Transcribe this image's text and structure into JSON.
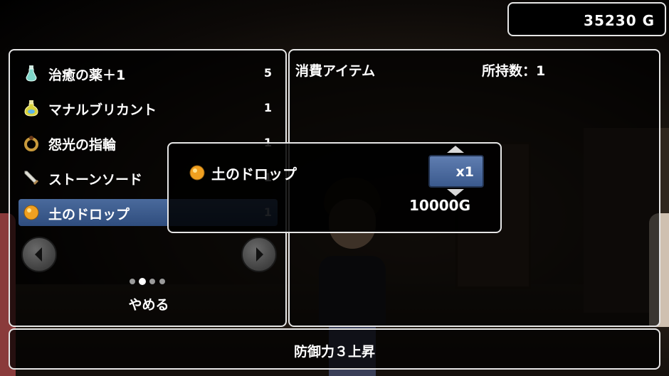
{
  "header": {
    "gold": "35230 G"
  },
  "item_list": {
    "items": [
      {
        "name": "治癒の薬＋1",
        "qty": "5",
        "icon": "potion-icon"
      },
      {
        "name": "マナルブリカント",
        "qty": "1",
        "icon": "mana-bottle-icon"
      },
      {
        "name": "怨光の指輪",
        "qty": "1",
        "icon": "ring-icon"
      },
      {
        "name": "ストーンソード",
        "qty": "1",
        "icon": "sword-icon"
      },
      {
        "name": "土のドロップ",
        "qty": "1",
        "icon": "orb-icon",
        "selected": true
      }
    ],
    "page_dots_total": 4,
    "page_dots_active": 2,
    "quit_label": "やめる"
  },
  "detail": {
    "category": "消費アイテム",
    "owned": "所持数：1"
  },
  "buy_dialog": {
    "item_name": "土のドロップ",
    "quantity": "x1",
    "price": "10000G"
  },
  "description": {
    "text": "防御力３上昇"
  },
  "colors": {
    "selected_row": "#3b5a8e",
    "panel_border": "#e6e6e6",
    "orb": "#f0a020"
  }
}
